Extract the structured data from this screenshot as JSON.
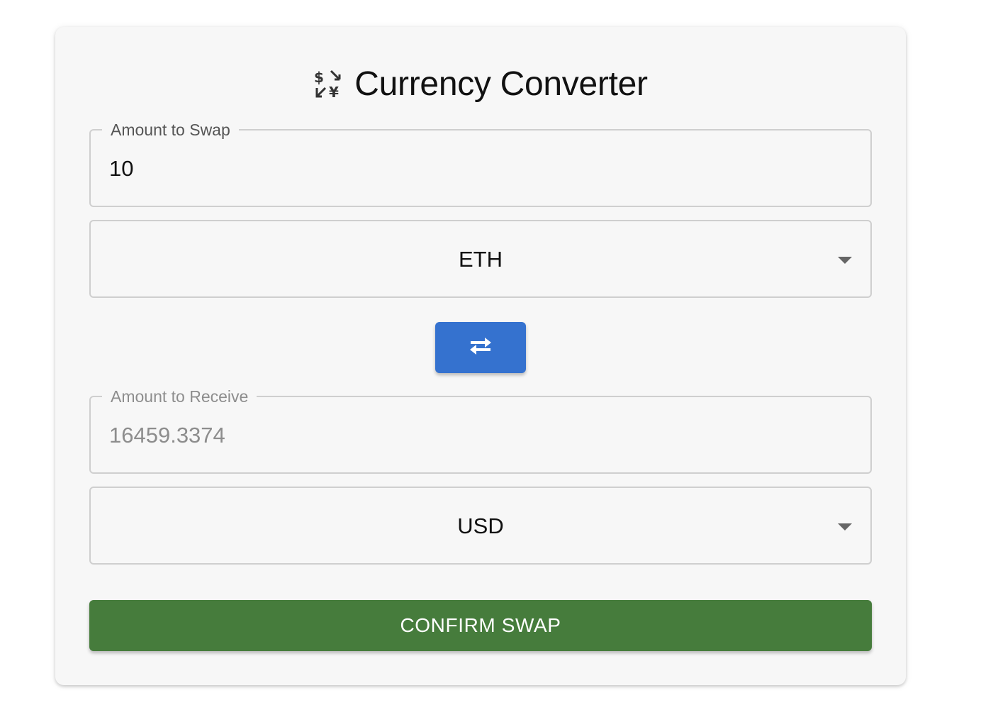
{
  "header": {
    "title": "Currency Converter",
    "icon": "currency-exchange-icon"
  },
  "from": {
    "label": "Amount to Swap",
    "amount": "10",
    "currency": "ETH"
  },
  "swap_button": {
    "icon": "swap-arrows-icon"
  },
  "to": {
    "label": "Amount to Receive",
    "amount": "16459.3374",
    "currency": "USD"
  },
  "confirm_button": {
    "label": "CONFIRM SWAP"
  },
  "colors": {
    "swap_button": "#3572cf",
    "confirm_button": "#467c3c",
    "card_background": "#f7f7f7"
  }
}
